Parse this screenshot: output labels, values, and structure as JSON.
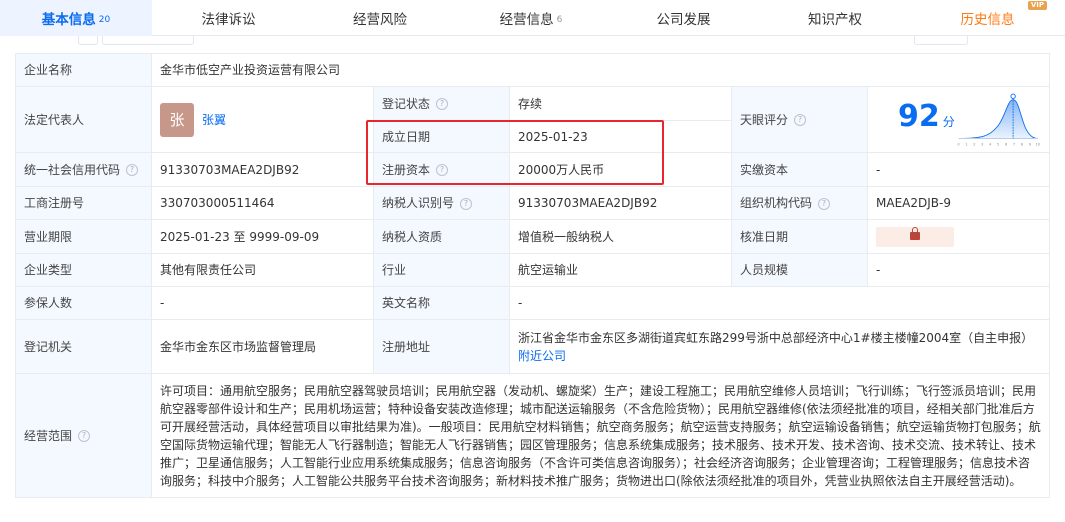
{
  "tabs": [
    {
      "label": "基本信息",
      "count": "20"
    },
    {
      "label": "法律诉讼",
      "count": ""
    },
    {
      "label": "经营风险",
      "count": ""
    },
    {
      "label": "经营信息",
      "count": "6"
    },
    {
      "label": "公司发展",
      "count": ""
    },
    {
      "label": "知识产权",
      "count": ""
    },
    {
      "label": "历史信息",
      "count": "",
      "badge": "VIP"
    }
  ],
  "company": {
    "name_label": "企业名称",
    "name": "金华市低空产业投资运营有限公司",
    "legal_rep_label": "法定代表人",
    "legal_rep_avatar": "张",
    "legal_rep": "张翼",
    "reg_status_label": "登记状态",
    "reg_status": "存续",
    "found_date_label": "成立日期",
    "found_date": "2025-01-23",
    "reg_capital_label": "注册资本",
    "reg_capital": "20000万人民币",
    "score_label": "天眼评分",
    "score": "92",
    "score_unit": "分",
    "score_chart": {
      "x_ticks": [
        "0",
        "1",
        "2",
        "3",
        "4",
        "5",
        "6",
        "7",
        "8",
        "9",
        "10"
      ],
      "marker_tick": "9"
    },
    "credit_code_label": "统一社会信用代码",
    "credit_code": "91330703MAEA2DJB92",
    "paid_capital_label": "实缴资本",
    "paid_capital": "-",
    "biz_reg_no_label": "工商注册号",
    "biz_reg_no": "330703000511464",
    "taxpayer_id_label": "纳税人识别号",
    "taxpayer_id": "91330703MAEA2DJB92",
    "org_code_label": "组织机构代码",
    "org_code": "MAEA2DJB-9",
    "term_label": "营业期限",
    "term": "2025-01-23 至 9999-09-09",
    "taxpayer_type_label": "纳税人资质",
    "taxpayer_type": "增值税一般纳税人",
    "approve_date_label": "核准日期",
    "company_type_label": "企业类型",
    "company_type": "其他有限责任公司",
    "industry_label": "行业",
    "industry": "航空运输业",
    "staff_size_label": "人员规模",
    "staff_size": "-",
    "insured_label": "参保人数",
    "insured": "-",
    "en_name_label": "英文名称",
    "en_name": "-",
    "authority_label": "登记机关",
    "authority": "金华市金东区市场监督管理局",
    "address_label": "注册地址",
    "address": "浙江省金华市金东区多湖街道宾虹东路299号浙中总部经济中心1#楼主楼幢2004室（自主申报）",
    "nearby_link": "附近公司",
    "scope_label": "经营范围",
    "scope": "许可项目：通用航空服务；民用航空器驾驶员培训；民用航空器（发动机、螺旋桨）生产；建设工程施工；民用航空维修人员培训；飞行训练；飞行签派员培训；民用航空器零部件设计和生产；民用机场运营；特种设备安装改造修理；城市配送运输服务（不含危险货物）；民用航空器维修(依法须经批准的项目，经相关部门批准后方可开展经营活动，具体经营项目以审批结果为准)。一般项目：民用航空材料销售；航空商务服务；航空运营支持服务；航空运输设备销售；航空运输货物打包服务；航空国际货物运输代理；智能无人飞行器制造；智能无人飞行器销售；园区管理服务；信息系统集成服务；技术服务、技术开发、技术咨询、技术交流、技术转让、技术推广；卫星通信服务；人工智能行业应用系统集成服务；信息咨询服务（不含许可类信息咨询服务）；社会经济咨询服务；企业管理咨询；工程管理服务；信息技术咨询服务；科技中介服务；人工智能公共服务平台技术咨询服务；新材料技术推广服务；货物进出口(除依法须经批准的项目外，凭营业执照依法自主开展经营活动)。"
  },
  "colors": {
    "accent": "#0a6cf0",
    "status_green": "#25a55a",
    "highlight_red": "#e8262e",
    "vip_orange": "#ff7a14"
  }
}
